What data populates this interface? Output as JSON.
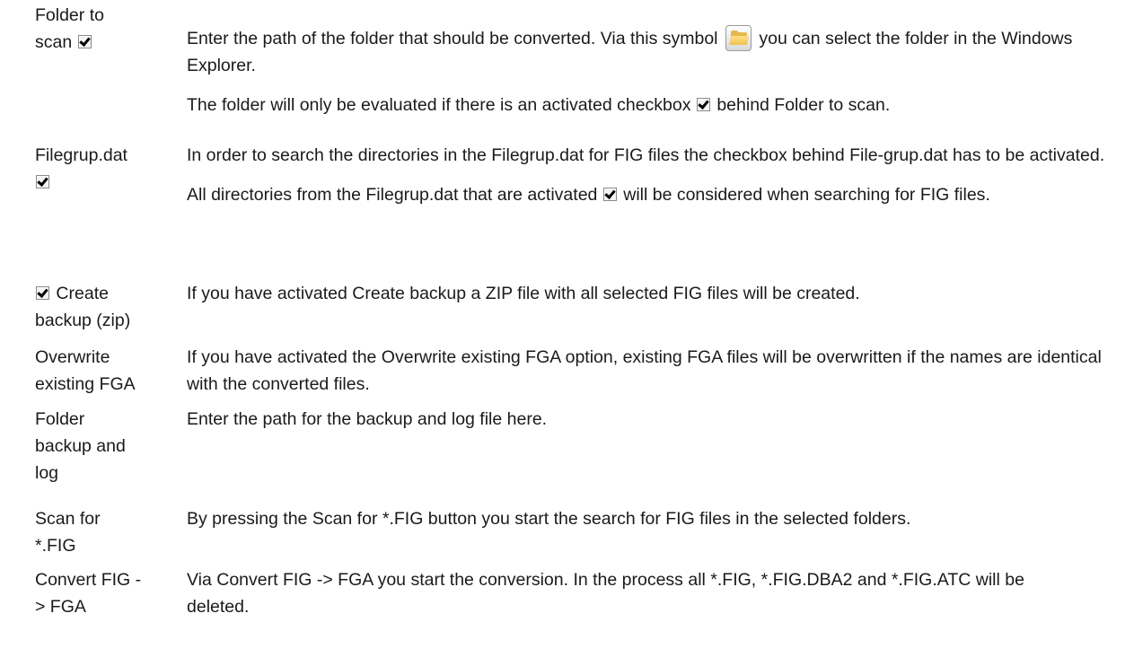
{
  "rows": [
    {
      "term": [
        "Folder to",
        "scan"
      ],
      "desc": [
        [
          "Enter the path of the folder that should be converted. Via this symbol",
          "you can select the folder in the Windows Explorer."
        ],
        [
          "The folder will only be evaluated if there is an activated checkbox",
          "behind Folder to scan."
        ]
      ]
    },
    {
      "term": [
        "Filegrup.dat"
      ],
      "desc": [
        [
          "In order to search the directories in the Filegrup.dat for FIG files the checkbox behind File-grup.dat has to be activated."
        ],
        [
          "All directories from the Filegrup.dat that are activated",
          "will be considered when searching for FIG files."
        ]
      ]
    },
    {
      "term": [
        "Create",
        "backup (zip)"
      ],
      "desc": [
        "If you have activated Create backup a ZIP file with all selected FIG files will be created."
      ]
    },
    {
      "term": [
        "Overwrite",
        "existing FGA"
      ],
      "desc": [
        "If you have activated the Overwrite existing FGA option, existing FGA files will be overwritten if the names are identical with the converted files."
      ]
    },
    {
      "term": [
        "Folder",
        "backup and",
        "log"
      ],
      "desc": [
        "Enter the path for the backup and log file here."
      ]
    },
    {
      "term": [
        "Scan for",
        "*.FIG"
      ],
      "desc": [
        "By pressing the Scan for *.FIG button you start the search for FIG files in the selected folders."
      ]
    },
    {
      "term": [
        "Convert FIG -",
        "> FGA"
      ],
      "desc": [
        "Via Convert FIG -> FGA you start the conversion. In the process all *.FIG, *.FIG.DBA2 and *.FIG.ATC will be deleted."
      ]
    }
  ]
}
